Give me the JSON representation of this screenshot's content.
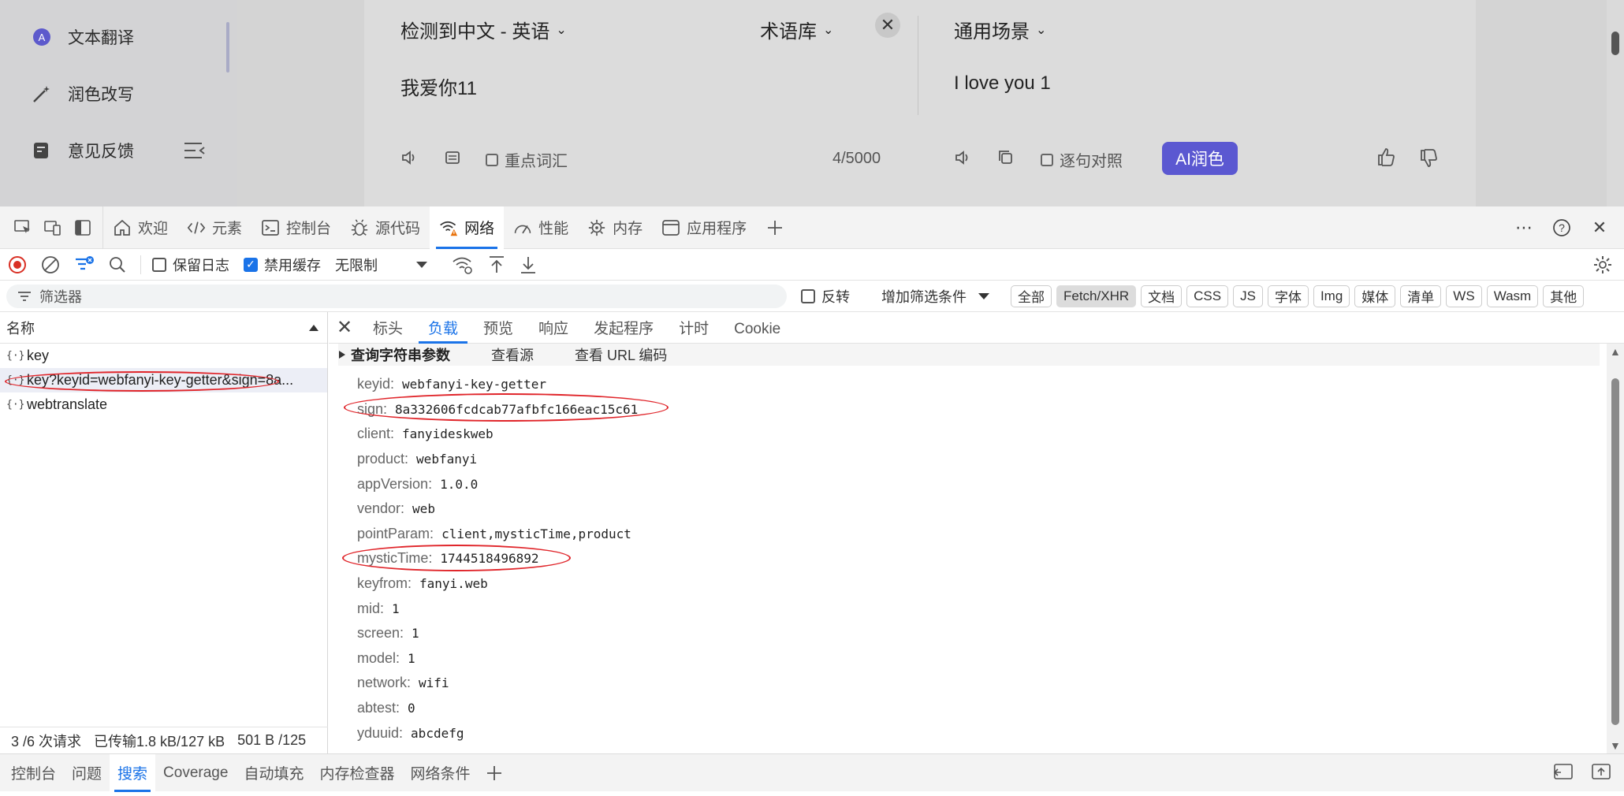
{
  "app": {
    "sidebar": [
      {
        "label": "文本翻译",
        "icon": "translate-icon"
      },
      {
        "label": "润色改写",
        "icon": "magic-wand-icon"
      },
      {
        "label": "意见反馈",
        "icon": "feedback-icon"
      }
    ],
    "source_lang": "检测到中文 - 英语",
    "glossary": "术语库",
    "scene": "通用场景",
    "source_text": "我爱你11",
    "target_text": "I love you 1",
    "key_words": "重点词汇",
    "char_count": "4/5000",
    "sentence_compare": "逐句对照",
    "ai_polish": "AI润色"
  },
  "devtools": {
    "tabs": [
      {
        "label": "欢迎",
        "icon": "home-icon"
      },
      {
        "label": "元素",
        "icon": "code-icon"
      },
      {
        "label": "控制台",
        "icon": "console-icon"
      },
      {
        "label": "源代码",
        "icon": "bug-icon"
      },
      {
        "label": "网络",
        "icon": "wifi-warning-icon"
      },
      {
        "label": "性能",
        "icon": "gauge-icon"
      },
      {
        "label": "内存",
        "icon": "memory-icon"
      },
      {
        "label": "应用程序",
        "icon": "app-icon"
      }
    ],
    "toolbar": {
      "preserve_log": "保留日志",
      "disable_cache": "禁用缓存",
      "throttle": "无限制"
    },
    "filter": {
      "placeholder": "筛选器",
      "invert": "反转",
      "more_filters": "增加筛选条件",
      "types": [
        "全部",
        "Fetch/XHR",
        "文档",
        "CSS",
        "JS",
        "字体",
        "Img",
        "媒体",
        "清单",
        "WS",
        "Wasm",
        "其他"
      ]
    },
    "requests": {
      "header": "名称",
      "rows": [
        "key",
        "key?keyid=webfanyi-key-getter&sign=8a...",
        "webtranslate"
      ],
      "footer": {
        "count": "3 /6 次请求",
        "transferred": "已传输1.8 kB/127 kB",
        "resources": "501 B /125"
      }
    },
    "detail": {
      "tabs": [
        "标头",
        "负载",
        "预览",
        "响应",
        "发起程序",
        "计时",
        "Cookie"
      ],
      "section": "查询字符串参数",
      "view_source": "查看源",
      "view_url": "查看 URL 编码",
      "params": [
        {
          "k": "keyid:",
          "v": "webfanyi-key-getter"
        },
        {
          "k": "sign:",
          "v": "8a332606fcdcab77afbfc166eac15c61"
        },
        {
          "k": "client:",
          "v": "fanyideskweb"
        },
        {
          "k": "product:",
          "v": "webfanyi"
        },
        {
          "k": "appVersion:",
          "v": "1.0.0"
        },
        {
          "k": "vendor:",
          "v": "web"
        },
        {
          "k": "pointParam:",
          "v": "client,mysticTime,product"
        },
        {
          "k": "mysticTime:",
          "v": "1744518496892"
        },
        {
          "k": "keyfrom:",
          "v": "fanyi.web"
        },
        {
          "k": "mid:",
          "v": "1"
        },
        {
          "k": "screen:",
          "v": "1"
        },
        {
          "k": "model:",
          "v": "1"
        },
        {
          "k": "network:",
          "v": "wifi"
        },
        {
          "k": "abtest:",
          "v": "0"
        },
        {
          "k": "yduuid:",
          "v": "abcdefg"
        }
      ]
    },
    "drawer": [
      "控制台",
      "问题",
      "搜索",
      "Coverage",
      "自动填充",
      "内存检查器",
      "网络条件"
    ]
  }
}
